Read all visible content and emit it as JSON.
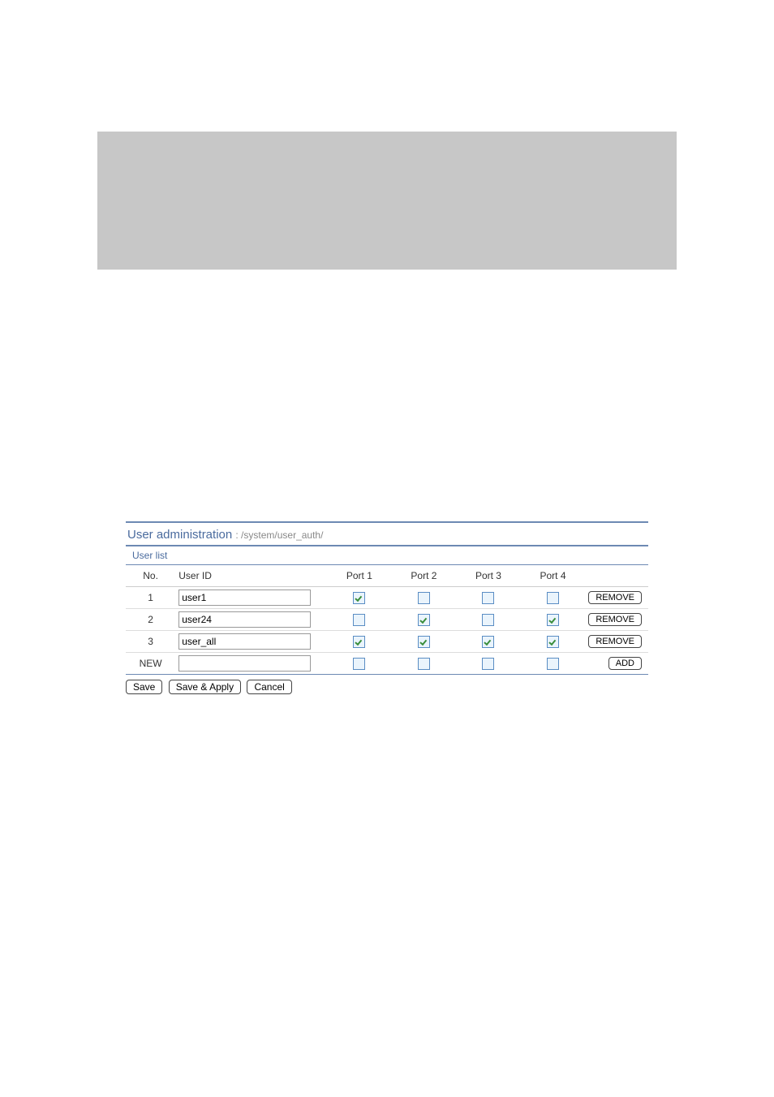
{
  "header": {
    "title": "User administration",
    "path": ": /system/user_auth/"
  },
  "section_label": "User list",
  "table": {
    "columns": {
      "no": "No.",
      "user_id": "User ID",
      "port1": "Port 1",
      "port2": "Port 2",
      "port3": "Port 3",
      "port4": "Port 4"
    },
    "rows": [
      {
        "no": "1",
        "user_id": "user1",
        "ports": [
          true,
          false,
          false,
          false
        ],
        "action": "REMOVE"
      },
      {
        "no": "2",
        "user_id": "user24",
        "ports": [
          false,
          true,
          false,
          true
        ],
        "action": "REMOVE"
      },
      {
        "no": "3",
        "user_id": "user_all",
        "ports": [
          true,
          true,
          true,
          true
        ],
        "action": "REMOVE"
      }
    ],
    "new_row": {
      "label": "NEW",
      "user_id": "",
      "ports": [
        false,
        false,
        false,
        false
      ],
      "action": "ADD"
    }
  },
  "footer": {
    "save": "Save",
    "save_apply": "Save & Apply",
    "cancel": "Cancel"
  }
}
